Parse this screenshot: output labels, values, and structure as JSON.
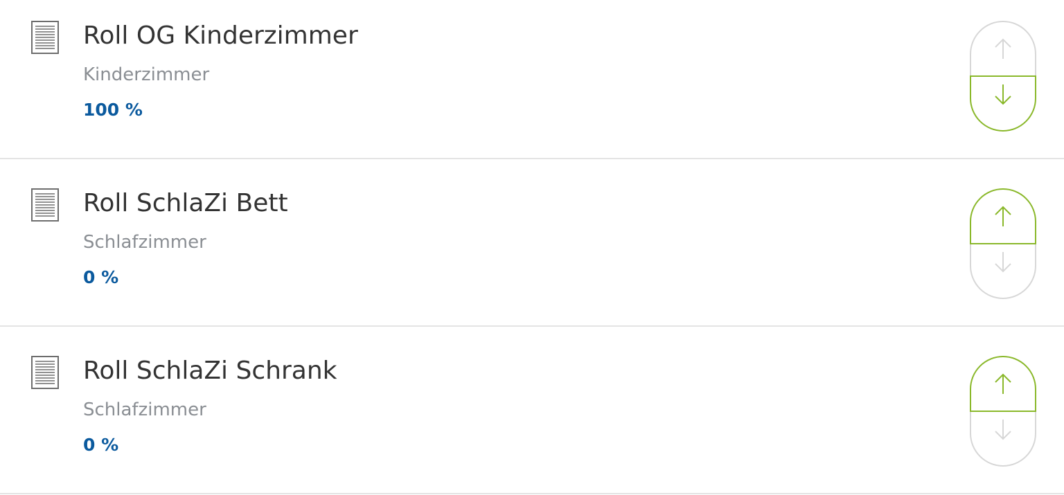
{
  "colors": {
    "active": "#8ab82a",
    "inactive": "#d7d7d7",
    "title": "#333333",
    "room": "#8a8e93",
    "value": "#0b5a9e",
    "divider": "#e4e4e4"
  },
  "devices": [
    {
      "title": "Roll OG Kinderzimmer",
      "room": "Kinderzimmer",
      "value": "100 %",
      "active_button": "down",
      "icon": "blinds-icon"
    },
    {
      "title": "Roll SchlaZi Bett",
      "room": "Schlafzimmer",
      "value": "0 %",
      "active_button": "up",
      "icon": "blinds-icon"
    },
    {
      "title": "Roll SchlaZi Schrank",
      "room": "Schlafzimmer",
      "value": "0 %",
      "active_button": "up",
      "icon": "blinds-icon"
    }
  ]
}
